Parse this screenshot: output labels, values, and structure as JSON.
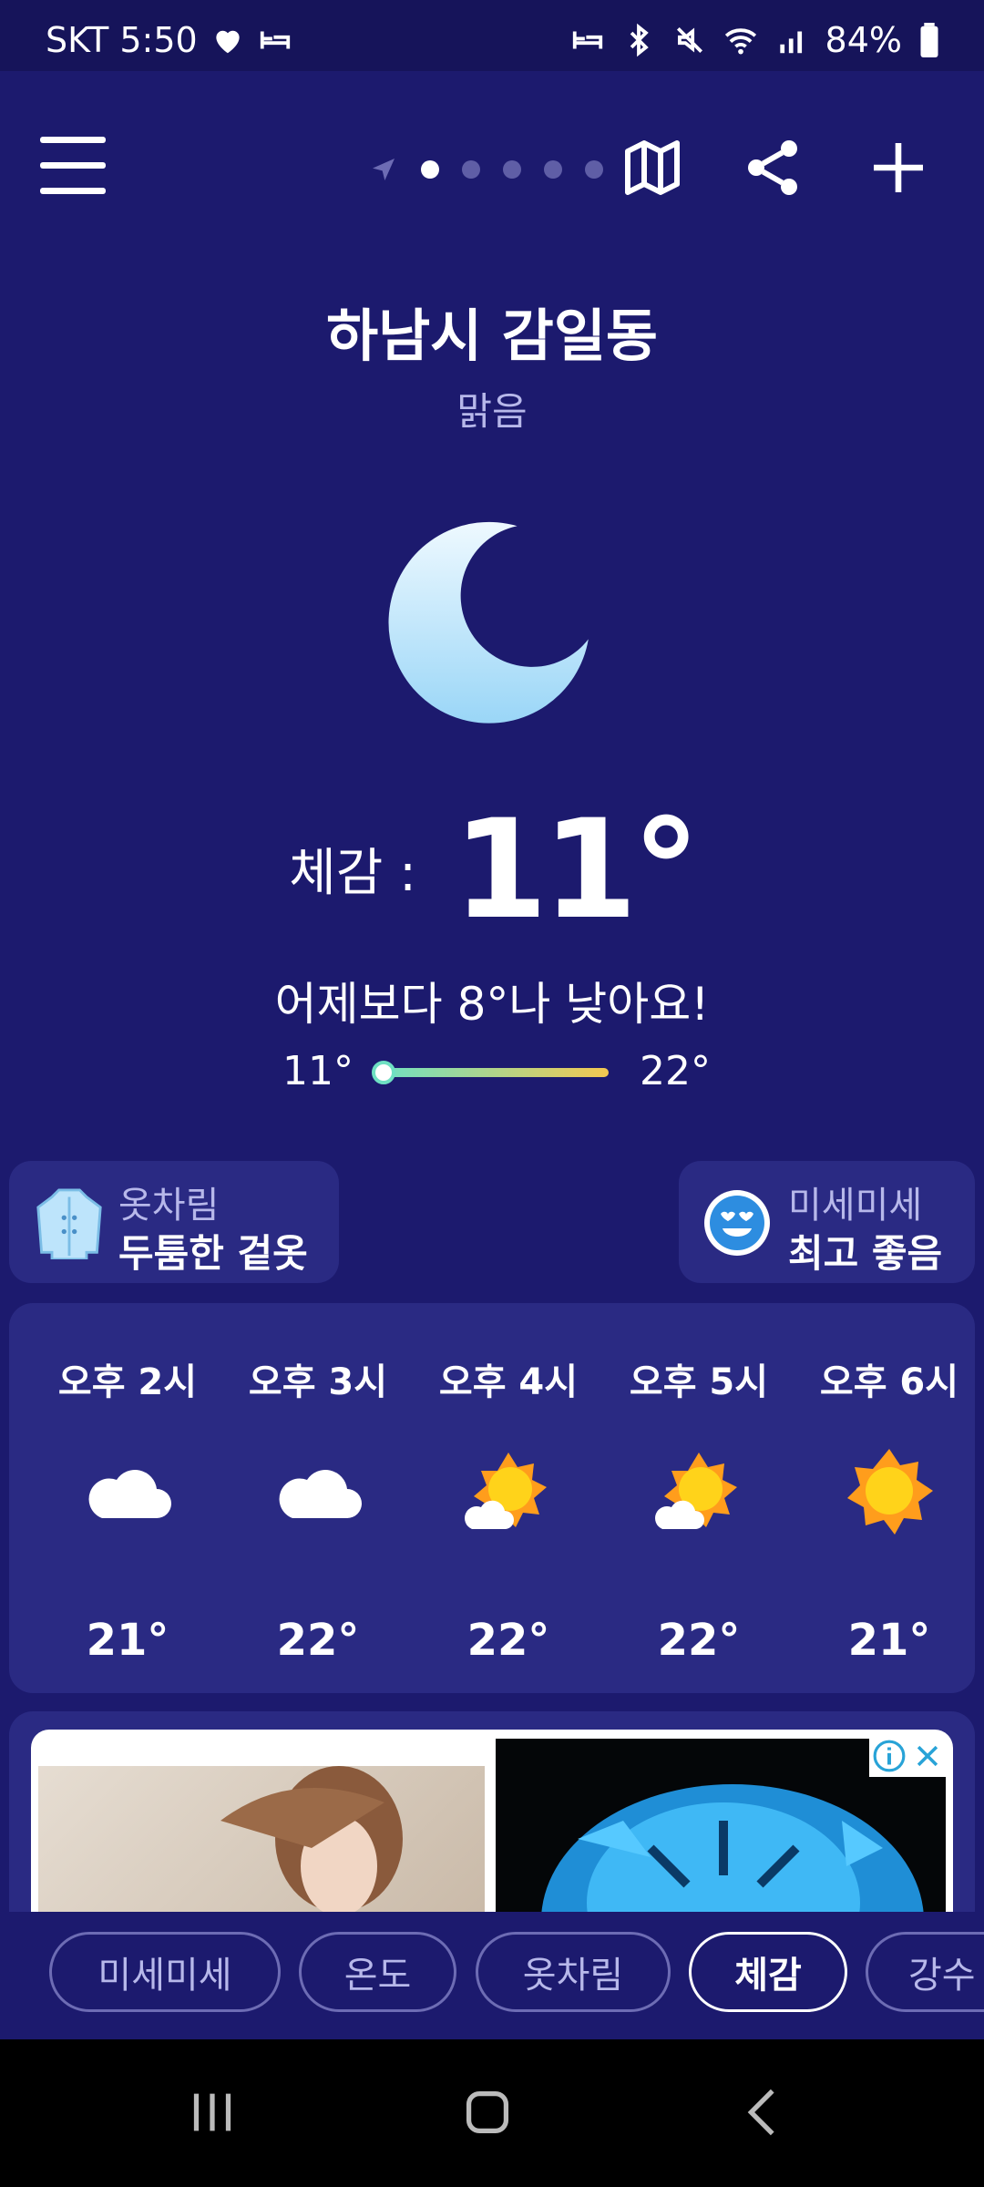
{
  "status": {
    "carrier_time": "SKT 5:50",
    "battery": "84%"
  },
  "topbar": {
    "icons": [
      "menu-icon",
      "location-arrow-icon",
      "map-icon",
      "share-icon",
      "plus-icon"
    ],
    "page_count": 5,
    "active_page": 1
  },
  "weather": {
    "location": "하남시 감일동",
    "condition": "맑음",
    "feels_label": "체감 :",
    "feels_temp": "11°",
    "compare": "어제보다 8°나 낮아요!",
    "range_min": "11°",
    "range_max": "22°"
  },
  "cards": {
    "outfit": {
      "title": "옷차림",
      "value": "두툼한 겉옷"
    },
    "dust": {
      "title": "미세미세",
      "value": "최고 좋음"
    }
  },
  "hourly": [
    {
      "time": "오후 2시",
      "icon": "cloud",
      "temp": "21°"
    },
    {
      "time": "오후 3시",
      "icon": "cloud",
      "temp": "22°"
    },
    {
      "time": "오후 4시",
      "icon": "sun-cloud",
      "temp": "22°"
    },
    {
      "time": "오후 5시",
      "icon": "sun-cloud",
      "temp": "22°"
    },
    {
      "time": "오후 6시",
      "icon": "sun",
      "temp": "21°"
    }
  ],
  "chips": [
    {
      "label": "미세미세",
      "active": false
    },
    {
      "label": "온도",
      "active": false
    },
    {
      "label": "옷차림",
      "active": false
    },
    {
      "label": "체감",
      "active": true
    },
    {
      "label": "강수",
      "active": false
    }
  ],
  "colors": {
    "background": "#1c1a6e",
    "card": "#2a2a83",
    "muted_text": "#b7b8ea",
    "range_start": "#6fe0c3",
    "range_end": "#f3c851"
  }
}
